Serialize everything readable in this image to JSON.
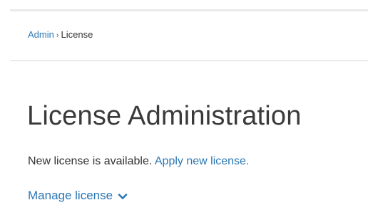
{
  "breadcrumb": {
    "items": [
      {
        "label": "Admin"
      },
      {
        "label": "License"
      }
    ],
    "separator": "›"
  },
  "page": {
    "title": "License Administration"
  },
  "notice": {
    "text": "New license is available.",
    "link_label": "Apply new license."
  },
  "manage": {
    "label": "Manage license",
    "icon": "chevron-down-icon"
  },
  "colors": {
    "link": "#2b77b4",
    "text": "#333333",
    "title": "#3a3a3a"
  }
}
